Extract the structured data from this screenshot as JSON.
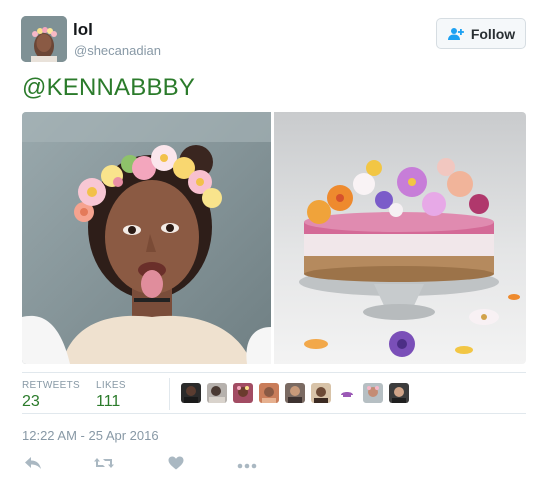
{
  "user": {
    "display_name": "lol",
    "screen_name": "@shecanadian"
  },
  "follow_button": {
    "label": "Follow",
    "icon": "follow-user-icon"
  },
  "tweet": {
    "text": "@KENNABBBY",
    "timestamp": "12:22 AM - 25 Apr 2016"
  },
  "media": {
    "left_photo": "selfie-with-flower-crown-filter",
    "right_photo": "flower-topped-cake-on-glass-stand"
  },
  "stats": {
    "retweets_label": "RETWEETS",
    "retweets_value": "23",
    "likes_label": "LIKES",
    "likes_value": "111"
  },
  "likers_count_shown": 9,
  "actions": {
    "reply": "reply-icon",
    "retweet": "retweet-icon",
    "like": "heart-icon",
    "more": "more-icon"
  },
  "colors": {
    "accent_green": "#2b7b2b",
    "muted_text": "#8899a6",
    "follow_icon_blue": "#1da1f2",
    "action_icon": "#aab8c2"
  }
}
